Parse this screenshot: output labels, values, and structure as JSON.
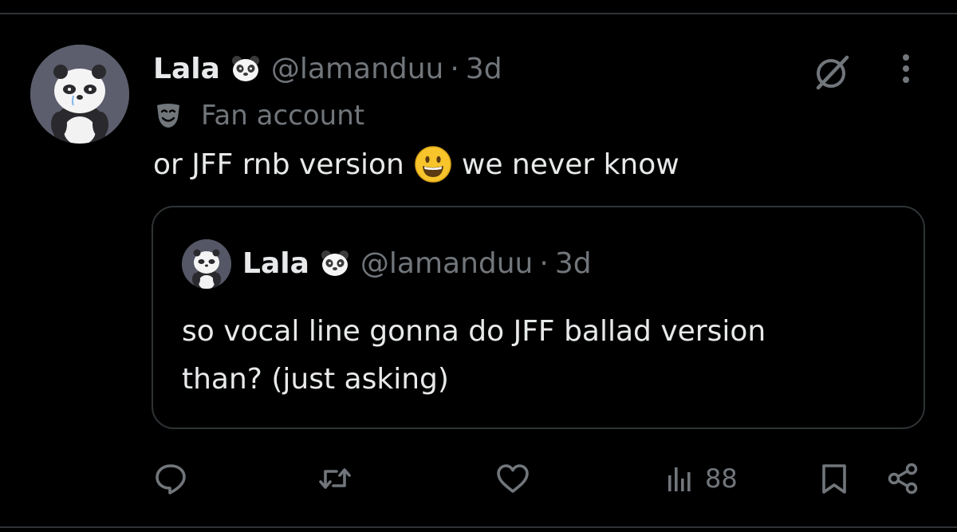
{
  "tweet": {
    "display_name": "Lala",
    "name_emoji": "panda",
    "handle": "@lamanduu",
    "separator": "·",
    "time": "3d",
    "label_icon": "theater-mask-icon",
    "label": "Fan account",
    "text_before_emoji": "or JFF rnb version",
    "inline_emoji": "grinning-face",
    "text_after_emoji": "we never know"
  },
  "quoted_tweet": {
    "display_name": "Lala",
    "name_emoji": "panda",
    "handle": "@lamanduu",
    "separator": "·",
    "time": "3d",
    "text_line_1": "so vocal line gonna do JFF ballad version",
    "text_line_2": "than? (just asking)"
  },
  "actions": {
    "views_count": "88",
    "icons": [
      "reply-icon",
      "retweet-icon",
      "like-icon",
      "views-icon",
      "bookmark-icon",
      "share-icon"
    ]
  },
  "header_icons": [
    "grok-icon",
    "more-options-icon"
  ],
  "colors": {
    "background": "#000000",
    "text_primary": "#e7e9ea",
    "text_secondary": "#71767b",
    "border": "#2f3336"
  }
}
